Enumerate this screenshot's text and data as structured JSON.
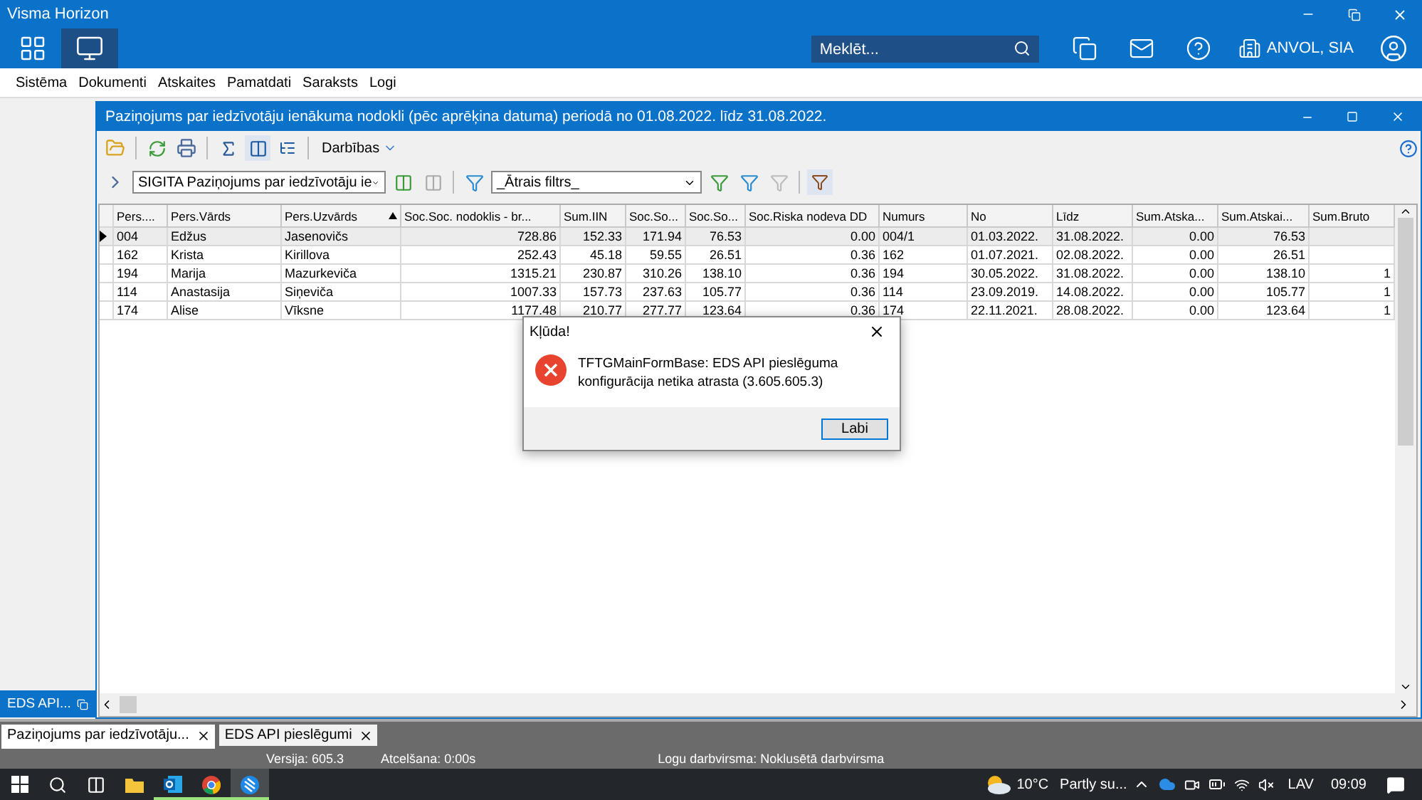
{
  "app_title": "Visma Horizon",
  "search": {
    "placeholder": "Meklēt..."
  },
  "company": "ANVOL, SIA",
  "menu": [
    "Sistēma",
    "Dokumenti",
    "Atskaites",
    "Pamatdati",
    "Saraksts",
    "Logi"
  ],
  "minimized": {
    "label": "EDS API..."
  },
  "child": {
    "title": "Paziņojums par iedzīvotāju ienākuma nodokli  (pēc aprēķina datuma) periodā no 01.08.2022. līdz 31.08.2022.",
    "actions_menu": "Darbības",
    "report_select": "SIGITA Paziņojums par iedzīvotāju ie",
    "filter_select": "_Ātrais filtrs_"
  },
  "table": {
    "columns": [
      {
        "label": "Pers....",
        "kind": "text",
        "sorted": false
      },
      {
        "label": "Pers.Vārds",
        "kind": "text",
        "sorted": false
      },
      {
        "label": "Pers.Uzvārds",
        "kind": "text",
        "sorted": true
      },
      {
        "label": "Soc.Soc. nodoklis - br...",
        "kind": "number",
        "sorted": false
      },
      {
        "label": "Sum.IIN",
        "kind": "number",
        "sorted": false
      },
      {
        "label": "Soc.So...",
        "kind": "number",
        "sorted": false
      },
      {
        "label": "Soc.So...",
        "kind": "number",
        "sorted": false
      },
      {
        "label": "Soc.Riska nodeva DD",
        "kind": "number",
        "sorted": false
      },
      {
        "label": "Numurs",
        "kind": "text",
        "sorted": false
      },
      {
        "label": "No",
        "kind": "text",
        "sorted": false
      },
      {
        "label": "Līdz",
        "kind": "text",
        "sorted": false
      },
      {
        "label": "Sum.Atska...",
        "kind": "number",
        "sorted": false
      },
      {
        "label": "Sum.Atskai...",
        "kind": "number",
        "sorted": false
      },
      {
        "label": "Sum.Bruto",
        "kind": "number",
        "sorted": false
      }
    ],
    "rows": [
      {
        "selected": true,
        "cells": [
          "004",
          "Edžus",
          "Jasenovičs",
          "728.86",
          "152.33",
          "171.94",
          "76.53",
          "0.00",
          "004/1",
          "01.03.2022.",
          "31.08.2022.",
          "0.00",
          "76.53",
          ""
        ]
      },
      {
        "selected": false,
        "cells": [
          "162",
          "Krista",
          "Kirillova",
          "252.43",
          "45.18",
          "59.55",
          "26.51",
          "0.36",
          "162",
          "01.07.2021.",
          "02.08.2022.",
          "0.00",
          "26.51",
          ""
        ]
      },
      {
        "selected": false,
        "cells": [
          "194",
          "Marija",
          "Mazurkeviča",
          "1315.21",
          "230.87",
          "310.26",
          "138.10",
          "0.36",
          "194",
          "30.05.2022.",
          "31.08.2022.",
          "0.00",
          "138.10",
          "1"
        ]
      },
      {
        "selected": false,
        "cells": [
          "114",
          "Anastasija",
          "Siņeviča",
          "1007.33",
          "157.73",
          "237.63",
          "105.77",
          "0.36",
          "114",
          "23.09.2019.",
          "14.08.2022.",
          "0.00",
          "105.77",
          "1"
        ]
      },
      {
        "selected": false,
        "cells": [
          "174",
          "Alise",
          "Vīksne",
          "1177.48",
          "210.77",
          "277.77",
          "123.64",
          "0.36",
          "174",
          "22.11.2021.",
          "28.08.2022.",
          "0.00",
          "123.64",
          "1"
        ]
      }
    ]
  },
  "dialog": {
    "title": "Kļūda!",
    "message": "TFTGMainFormBase: EDS API pieslēguma konfigurācija netika atrasta (3.605.605.3)",
    "button": "Labi"
  },
  "doc_tabs": [
    {
      "label": "Paziņojums par iedzīvotāju...",
      "selected": true
    },
    {
      "label": "EDS API pieslēgumi",
      "selected": false
    }
  ],
  "status_bar": [
    "Versija: 605.3",
    "Atcelšana: 0:00s",
    "Logu darbvirsma: Noklusētā darbvirsma"
  ],
  "taskbar": {
    "apps": [
      {
        "kind": "folder",
        "running": false,
        "active": false
      },
      {
        "kind": "mail",
        "running": true,
        "active": false
      },
      {
        "kind": "browser",
        "running": true,
        "active": false
      },
      {
        "kind": "visma",
        "running": true,
        "active": true
      }
    ],
    "weather_temp": "10°C",
    "weather_text": "Partly su...",
    "language": "LAV",
    "time": "09:09"
  }
}
